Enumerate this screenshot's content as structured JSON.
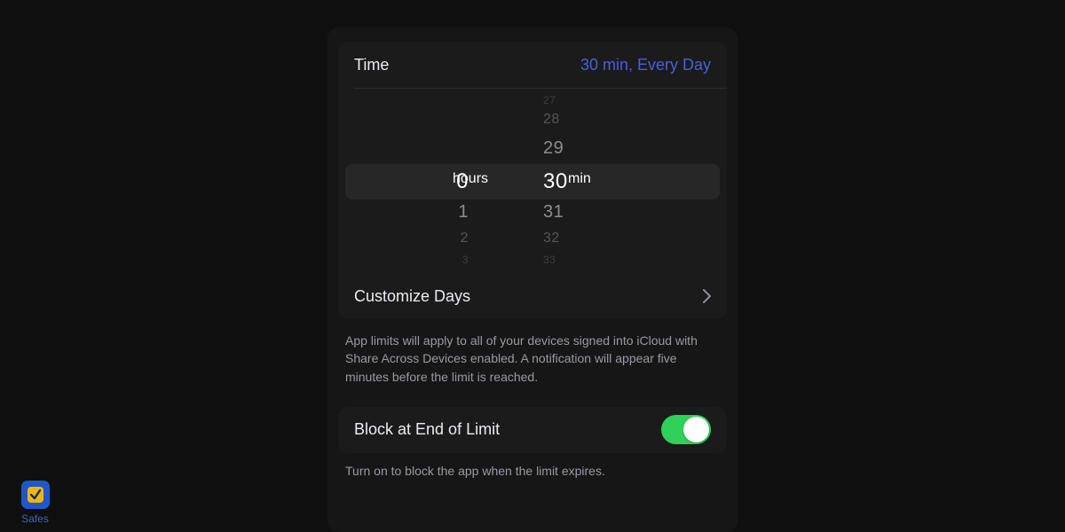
{
  "time": {
    "label": "Time",
    "summary": "30 min, Every Day",
    "hours_unit": "hours",
    "mins_unit": "min",
    "selected_hours": "0",
    "selected_mins": "30",
    "hours_wheel": [
      "0",
      "1",
      "2",
      "3"
    ],
    "mins_wheel": [
      "27",
      "28",
      "29",
      "30",
      "31",
      "32",
      "33"
    ]
  },
  "customize": {
    "label": "Customize Days"
  },
  "notes": {
    "devices": "App limits will apply to all of your devices signed into iCloud with Share Across Devices enabled. A notification will appear five minutes before the limit is reached.",
    "block": "Turn on to block the app when the limit expires."
  },
  "block": {
    "label": "Block at End of Limit",
    "on": true
  },
  "dock": {
    "app_label": "Safes"
  }
}
